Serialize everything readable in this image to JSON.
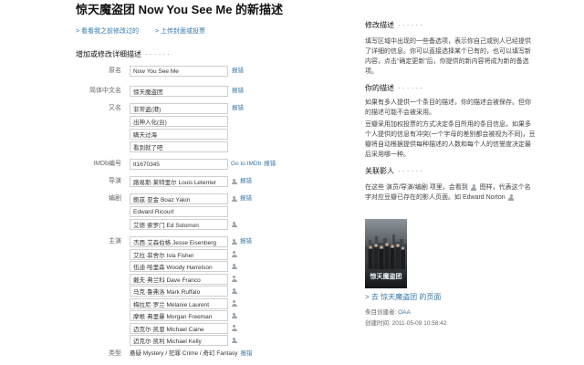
{
  "page": {
    "title": "惊天魔盗团 Now You See Me 的新描述"
  },
  "links": {
    "history": "> 看看我之前修改过的",
    "upload": "> 上传封面或投票"
  },
  "ui": {
    "dots": "· · · · · ·",
    "report": "报错"
  },
  "icons": {
    "person": "person-icon"
  },
  "colors": {
    "link": "#3377aa",
    "text": "#111111",
    "label": "#666666",
    "input_border": "#cfcfcf"
  },
  "form": {
    "heading": "增加或修改详细描述",
    "original_title": {
      "label": "原名",
      "value": "Now You See Me"
    },
    "chinese_title": {
      "label": "简体中文名",
      "value": "惊天魔盗团"
    },
    "aka": {
      "label": "又名",
      "values": [
        "非常盗(港)",
        "出神入化(台)",
        "瞒天过海",
        "看到就了吧"
      ]
    },
    "imdb": {
      "label": "IMDb编号",
      "value": "tt1670345",
      "link": "Go to IMDb"
    },
    "director": {
      "label": "导演",
      "values": [
        "路易斯·莱特里尔 Louis Leterrier"
      ]
    },
    "writers": {
      "label": "编剧",
      "values": [
        "鲍兹·亚金 Boaz Yakin",
        "Edward Ricourt",
        "艾德·索罗门 Ed Solomon"
      ]
    },
    "cast": {
      "label": "主演",
      "values": [
        "杰西·艾森伯格 Jesse Eisenberg",
        "艾拉·菲舍尔 Isla Fisher",
        "伍迪·哈里森 Woody Harrelson",
        "戴夫·弗兰科 Dave Franco",
        "马克·鲁弗洛 Mark Ruffalo",
        "梅拉尼·罗兰 Mélanie Laurent",
        "摩根·弗里曼 Morgan Freeman",
        "迈克尔·凯恩 Michael Caine",
        "迈克尔·凯利 Michael Kelly"
      ]
    },
    "genre": {
      "label": "类型",
      "value": "悬疑 Mystery / 犯罪 Crime / 奇幻 Fantasy"
    }
  },
  "sidebar": {
    "edit_help": {
      "heading": "修改描述",
      "text": "填写区域中出现的一些备选项，表示你自己或别人已经提供了详细的信息。你可以直接选择某个已有的，也可以填写新内容，点击“确定更新”后，你提供的新内容将成为新的备选项。"
    },
    "your_desc": {
      "heading": "你的描述",
      "p1": "如果有多人提供一个条目的描述，你的描述会被保存。但你的描述可能不会被采用。",
      "p2": "豆瓣采用加权投票的方式决定条目所用的条目信息。如果多个人提供的信息有冲突(一个字母的差别都会被视为不同)，豆瓣将自动根据提供每种描述的人数和每个人的信誉度决定最后采用哪一种。"
    },
    "related": {
      "heading": "关联影人",
      "text_before": "在这些 演员/导演/编剧 项里，会看到",
      "text_after": "图样，代表这个名字对应豆瓣已存在的影人页面。如 Edward Norton"
    },
    "poster": {
      "title": "惊天魔盗团"
    },
    "movie_link": "> 去 惊天魔盗团 的页面",
    "creator_label": "条目创建者:",
    "creator": "OAA",
    "created_label": "创建时间:",
    "created": "2011-05-09 10:58:42"
  }
}
